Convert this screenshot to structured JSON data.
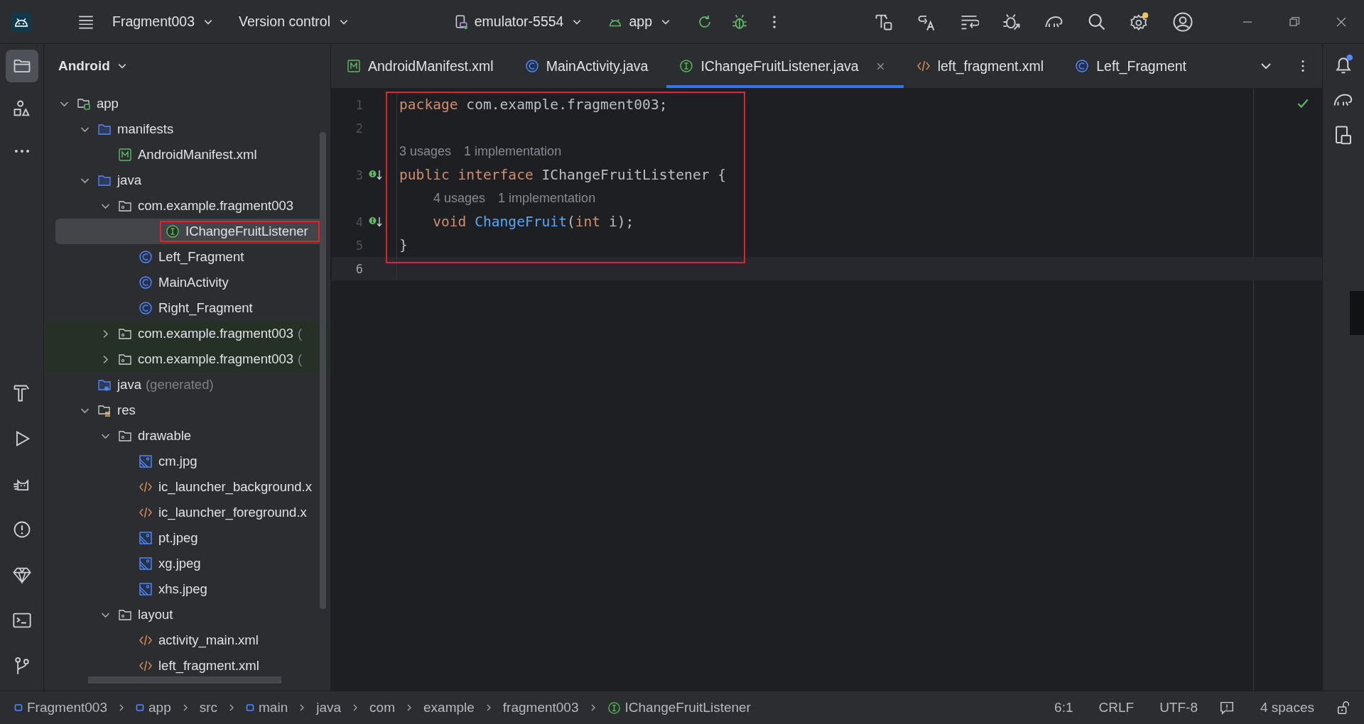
{
  "toolbar": {
    "project": "Fragment003",
    "vcs": "Version control",
    "device": "emulator-5554",
    "run_config": "app",
    "settings_badge": true
  },
  "left_rail": [
    {
      "kind": "project",
      "selected": true
    },
    {
      "kind": "structure",
      "selected": false
    },
    {
      "kind": "more",
      "selected": false
    }
  ],
  "left_rail_bottom": [
    {
      "kind": "build",
      "selected": false
    },
    {
      "kind": "run",
      "selected": false
    },
    {
      "kind": "logcat",
      "selected": false
    },
    {
      "kind": "problems",
      "selected": false
    },
    {
      "kind": "quality",
      "selected": false
    },
    {
      "kind": "terminal",
      "selected": false
    },
    {
      "kind": "git",
      "selected": false
    }
  ],
  "right_rail": {
    "notifications_badge": true
  },
  "project_panel": {
    "view": "Android",
    "tree": [
      {
        "label": "app",
        "kind": "module",
        "expanded": true,
        "selected": false,
        "test": false,
        "children": [
          {
            "label": "manifests",
            "kind": "folder",
            "expanded": true,
            "selected": false,
            "test": false,
            "children": [
              {
                "label": "AndroidManifest.xml",
                "kind": "manifest",
                "selected": false,
                "test": false
              }
            ]
          },
          {
            "label": "java",
            "kind": "folder",
            "expanded": true,
            "selected": false,
            "test": false,
            "children": [
              {
                "label": "com.example.fragment003",
                "kind": "package",
                "expanded": true,
                "selected": false,
                "test": false,
                "children": [
                  {
                    "label": "IChangeFruitListener",
                    "kind": "interface",
                    "selected": true,
                    "test": false,
                    "highlighted": true
                  },
                  {
                    "label": "Left_Fragment",
                    "kind": "class",
                    "selected": false,
                    "test": false
                  },
                  {
                    "label": "MainActivity",
                    "kind": "class",
                    "selected": false,
                    "test": false
                  },
                  {
                    "label": "Right_Fragment",
                    "kind": "class",
                    "selected": false,
                    "test": false
                  }
                ]
              },
              {
                "label": "com.example.fragment003",
                "suffix": "(",
                "kind": "package",
                "expanded": false,
                "selected": false,
                "test": true
              },
              {
                "label": "com.example.fragment003",
                "suffix": "(",
                "kind": "package",
                "expanded": false,
                "selected": false,
                "test": true
              }
            ]
          },
          {
            "label": "java",
            "suffix": "(generated)",
            "kind": "generated",
            "selected": false,
            "test": false
          },
          {
            "label": "res",
            "kind": "res",
            "expanded": true,
            "selected": false,
            "test": false,
            "children": [
              {
                "label": "drawable",
                "kind": "package",
                "expanded": true,
                "selected": false,
                "test": false,
                "children": [
                  {
                    "label": "cm.jpg",
                    "kind": "image",
                    "selected": false,
                    "test": false
                  },
                  {
                    "label": "ic_launcher_background.x",
                    "kind": "xml",
                    "selected": false,
                    "test": false
                  },
                  {
                    "label": "ic_launcher_foreground.x",
                    "kind": "xml",
                    "selected": false,
                    "test": false
                  },
                  {
                    "label": "pt.jpeg",
                    "kind": "image",
                    "selected": false,
                    "test": false
                  },
                  {
                    "label": "xg.jpeg",
                    "kind": "image",
                    "selected": false,
                    "test": false
                  },
                  {
                    "label": "xhs.jpeg",
                    "kind": "image",
                    "selected": false,
                    "test": false
                  }
                ]
              },
              {
                "label": "layout",
                "kind": "package",
                "expanded": true,
                "selected": false,
                "test": false,
                "children": [
                  {
                    "label": "activity_main.xml",
                    "kind": "xml",
                    "selected": false,
                    "test": false
                  },
                  {
                    "label": "left_fragment.xml",
                    "kind": "xml",
                    "selected": false,
                    "test": false
                  }
                ]
              }
            ]
          }
        ]
      }
    ]
  },
  "tabs": [
    {
      "label": "AndroidManifest.xml",
      "kind": "manifest",
      "selected": false
    },
    {
      "label": "MainActivity.java",
      "kind": "class",
      "selected": false
    },
    {
      "label": "IChangeFruitListener.java",
      "kind": "interface",
      "selected": true
    },
    {
      "label": "left_fragment.xml",
      "kind": "xml",
      "selected": false
    },
    {
      "label": "Left_Fragment",
      "kind": "class",
      "selected": false
    }
  ],
  "editor": {
    "highlighted": true,
    "status_ok": true,
    "lines": [
      {
        "kind": "code",
        "number": "1",
        "current": false,
        "implemented": false,
        "tokens": [
          {
            "text": "package",
            "kind": "keyword"
          },
          {
            "text": " com.example.fragment003;",
            "kind": "plain"
          }
        ]
      },
      {
        "kind": "code",
        "number": "2",
        "current": false,
        "implemented": false
      },
      {
        "kind": "hint",
        "inside": false,
        "parts": [
          "3 usages",
          "1 implementation"
        ]
      },
      {
        "kind": "code",
        "number": "3",
        "current": false,
        "implemented": true,
        "tokens": [
          {
            "text": "public",
            "kind": "keyword"
          },
          {
            "text": " interface",
            "kind": "keyword"
          },
          {
            "text": " IChangeFruitListener {",
            "kind": "plain"
          }
        ]
      },
      {
        "kind": "hint",
        "inside": true,
        "parts": [
          "4 usages",
          "1 implementation"
        ]
      },
      {
        "kind": "code",
        "number": "4",
        "current": false,
        "implemented": true,
        "tokens": [
          {
            "text": "    void",
            "kind": "keyword"
          },
          {
            "text": " ChangeFruit",
            "kind": "function"
          },
          {
            "text": "(",
            "kind": "plain"
          },
          {
            "text": "int",
            "kind": "keyword"
          },
          {
            "text": " i);",
            "kind": "plain"
          }
        ]
      },
      {
        "kind": "code",
        "number": "5",
        "current": false,
        "implemented": false,
        "tokens": [
          {
            "text": "}",
            "kind": "plain"
          }
        ]
      },
      {
        "kind": "code",
        "number": "6",
        "current": true,
        "implemented": false
      }
    ]
  },
  "breadcrumbs": [
    {
      "label": "Fragment003",
      "kind": "module"
    },
    {
      "label": "app",
      "kind": "module"
    },
    {
      "label": "src",
      "kind": "plain"
    },
    {
      "label": "main",
      "kind": "module"
    },
    {
      "label": "java",
      "kind": "plain"
    },
    {
      "label": "com",
      "kind": "plain"
    },
    {
      "label": "example",
      "kind": "plain"
    },
    {
      "label": "fragment003",
      "kind": "plain"
    },
    {
      "label": "IChangeFruitListener",
      "kind": "interface"
    }
  ],
  "status": {
    "position": "6:1",
    "line_ending": "CRLF",
    "encoding": "UTF-8",
    "indent": "4 spaces"
  }
}
